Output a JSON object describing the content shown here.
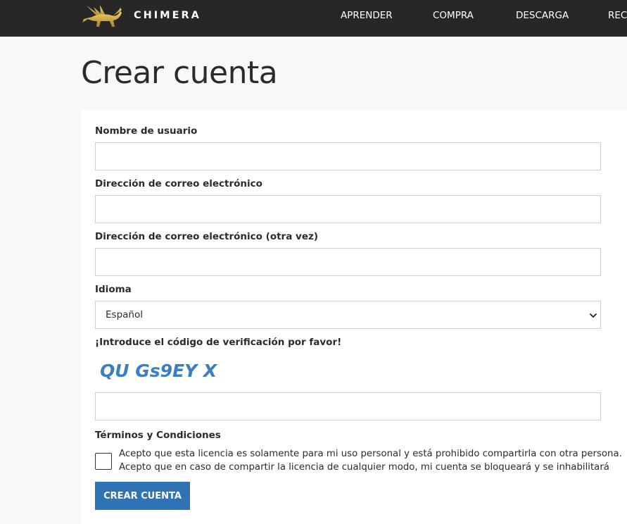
{
  "header": {
    "brand": "CHIMERA",
    "nav": [
      {
        "label": "APRENDER"
      },
      {
        "label": "COMPRA"
      },
      {
        "label": "DESCARGA"
      },
      {
        "label": "REC"
      }
    ]
  },
  "page": {
    "title": "Crear cuenta"
  },
  "form": {
    "username": {
      "label": "Nombre de usuario",
      "value": ""
    },
    "email": {
      "label": "Dirección de correo electrónico",
      "value": ""
    },
    "email_confirm": {
      "label": "Dirección de correo electrónico (otra vez)",
      "value": ""
    },
    "language": {
      "label": "Idioma",
      "selected": "Español"
    },
    "captcha": {
      "label": "¡Introduce el código de verificación por favor!",
      "image_text": "QU Gs9EY X",
      "value": ""
    },
    "terms": {
      "label": "Términos y Condiciones",
      "checked": false,
      "line1": "Acepto que esta licencia es solamente para mi uso personal y está prohibido compartirla con otra persona.",
      "line2": "Acepto que en caso de compartir la licencia de cualquier modo, mi cuenta se bloqueará y se inhabilitará"
    },
    "submit_label": "CREAR CUENTA"
  },
  "colors": {
    "topbar": "#272727",
    "accent": "#2f73b4",
    "captcha": "#3b7fc0",
    "logo_gold": "#c9a43a"
  }
}
